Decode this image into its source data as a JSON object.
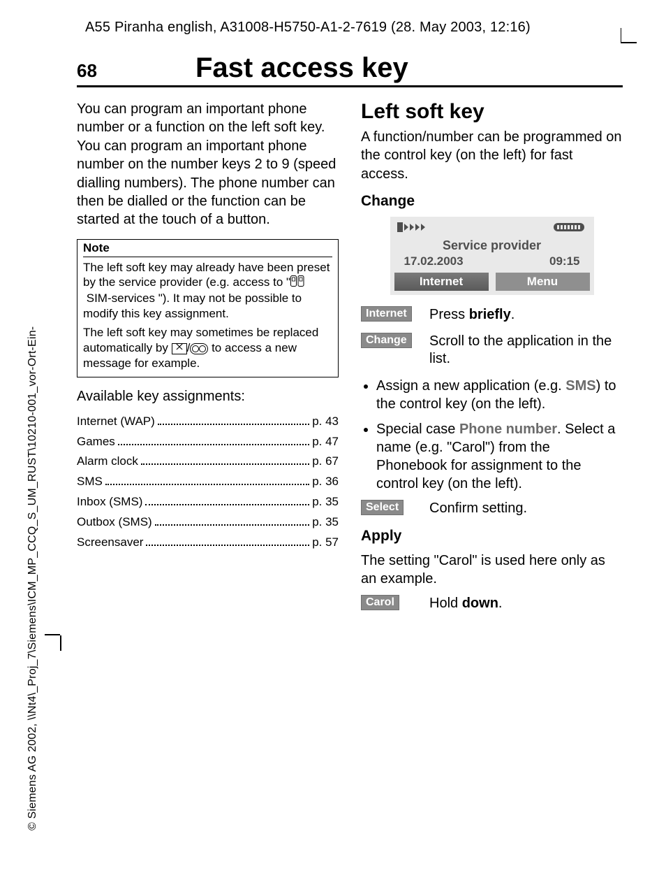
{
  "header_line": "A55 Piranha english, A31008-H5750-A1-2-7619 (28. May 2003, 12:16)",
  "page_number": "68",
  "page_title": "Fast access key",
  "left_col": {
    "intro": "You can program an important phone number or a function on the left soft key. You can program an important phone number on the number keys 2 to 9 (speed dialling numbers). The phone number can then be dialled or the function can be started at the touch of a button.",
    "note_title": "Note",
    "note_p1_pre": "The left soft key may already have been preset by the service provider (e.g. access to \"",
    "note_p1_sim": "SIM-services",
    "note_p1_post": " \"). It may not be possible to modify this key assignment.",
    "note_p2_pre": "The left soft key may sometimes be replaced automatically by ",
    "note_p2_mid": "/",
    "note_p2_post": " to access a new message for example.",
    "avail_heading": "Available key assignments:",
    "toc": [
      {
        "label": "Internet (WAP)",
        "page": "p. 43"
      },
      {
        "label": "Games",
        "page": "p. 47"
      },
      {
        "label": "Alarm clock",
        "page": "p. 67"
      },
      {
        "label": "SMS",
        "page": "p. 36"
      },
      {
        "label": "Inbox (SMS)",
        "page": "p. 35"
      },
      {
        "label": "Outbox (SMS)",
        "page": "p. 35"
      },
      {
        "label": "Screensaver",
        "page": "p. 57"
      }
    ]
  },
  "right_col": {
    "h2": "Left soft key",
    "intro": "A function/number can be programmed on the control key (on the left) for fast access.",
    "h3_change": "Change",
    "phone": {
      "provider": "Service provider",
      "date": "17.02.2003",
      "time": "09:15",
      "soft_left": "Internet",
      "soft_right": "Menu"
    },
    "steps": {
      "internet_label": "Internet",
      "internet_text_pre": "Press ",
      "internet_text_b": "briefly",
      "internet_text_post": ".",
      "change_label": "Change",
      "change_text": "Scroll to the application in the list."
    },
    "bullets": {
      "b1_pre": "Assign a new application (e.g. ",
      "b1_em": "SMS",
      "b1_post": ") to the control key (on the left).",
      "b2_pre": "Special case ",
      "b2_em": "Phone number",
      "b2_post": ". Select a name (e.g. \"Carol\") from the Phonebook for assignment to the control key (on the left)."
    },
    "select": {
      "label": "Select",
      "text": "Confirm setting."
    },
    "h3_apply": "Apply",
    "apply_text": "The setting \"Carol\" is used here only as an example.",
    "carol": {
      "label": "Carol",
      "pre": "Hold ",
      "b": "down",
      "post": "."
    }
  },
  "side_text": "© Siemens AG 2002, \\\\Nt4\\_Proj_7\\Siemens\\ICM_MP_CCQ_S_UM_RUST\\10210-001_vor-Ort-Ein-"
}
